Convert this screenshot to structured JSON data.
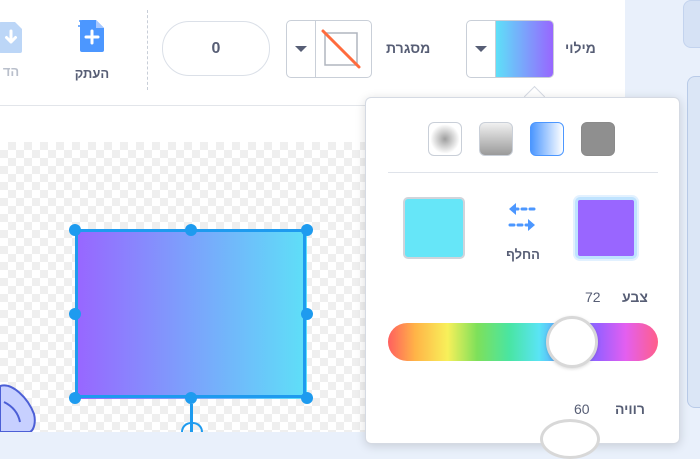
{
  "toolbar": {
    "copy_label": "העתק",
    "paste_label_partial": "הד",
    "outline_width_value": "0",
    "outline_label": "מסגרת",
    "fill_label": "מילוי"
  },
  "fill_popover": {
    "swap_label": "החלף",
    "hue": {
      "label": "צבע",
      "value": "72"
    },
    "saturation": {
      "label": "רוויה",
      "value": "60"
    },
    "first_color": "#9966ff",
    "second_color": "#66e6f8"
  },
  "colors": {
    "accent": "#1e9bef",
    "gradient_start": "#9866ff",
    "gradient_end": "#5ee0f8",
    "swatch_selected_border": "#855cd6",
    "outline_no_color": "#ff6b3d"
  },
  "icons": {
    "paste": "download-document-icon",
    "copy": "copy-document-icon",
    "swap": "swap-arrows-icon",
    "outline_none": "no-color-slash-icon"
  }
}
